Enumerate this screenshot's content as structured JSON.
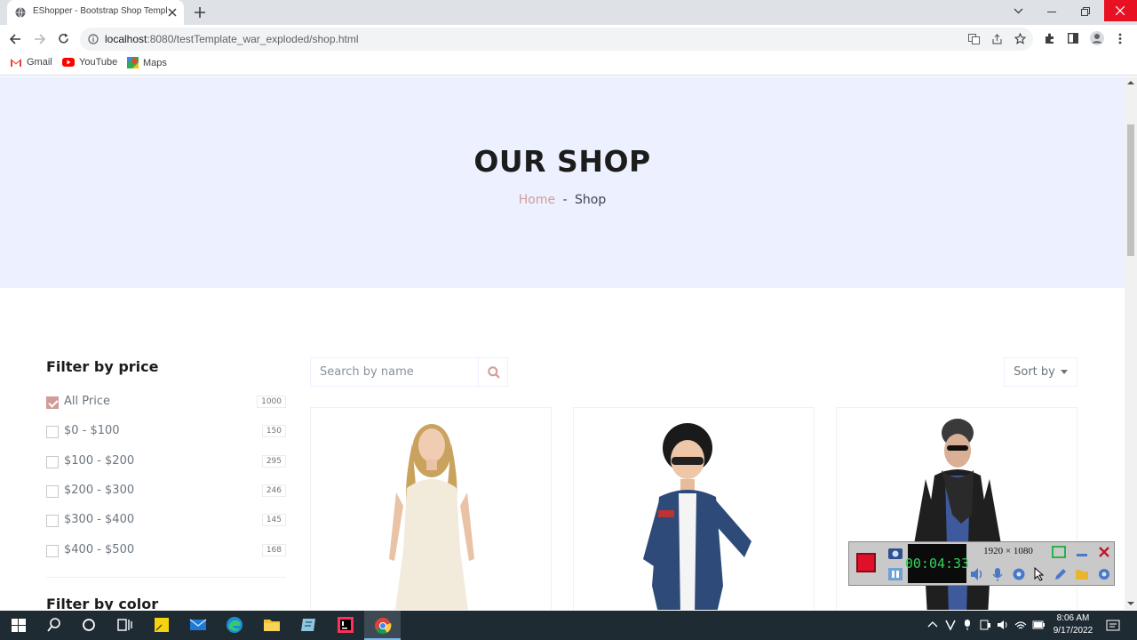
{
  "browser": {
    "tab_title": "EShopper - Bootstrap Shop Template",
    "url_host": "localhost",
    "url_rest": ":8080/testTemplate_war_exploded/shop.html",
    "bookmarks": [
      "Gmail",
      "YouTube",
      "Maps"
    ]
  },
  "hero": {
    "title": "OUR SHOP",
    "breadcrumb_home": "Home",
    "breadcrumb_sep": "-",
    "breadcrumb_current": "Shop"
  },
  "sidebar": {
    "price_heading": "Filter by price",
    "color_heading": "Filter by color",
    "price_filters": [
      {
        "label": "All Price",
        "count": "1000",
        "checked": true
      },
      {
        "label": "$0 - $100",
        "count": "150",
        "checked": false
      },
      {
        "label": "$100 - $200",
        "count": "295",
        "checked": false
      },
      {
        "label": "$200 - $300",
        "count": "246",
        "checked": false
      },
      {
        "label": "$300 - $400",
        "count": "145",
        "checked": false
      },
      {
        "label": "$400 - $500",
        "count": "168",
        "checked": false
      }
    ]
  },
  "toolbar": {
    "search_placeholder": "Search by name",
    "sort_label": "Sort by"
  },
  "recorder": {
    "time": "00:04:33",
    "resolution": "1920 × 1080"
  },
  "taskbar": {
    "time": "8:06 AM",
    "date": "9/17/2022"
  },
  "colors": {
    "accent": "#d19c97",
    "hero_bg": "#edf1ff",
    "taskbar_bg": "#1f2b33"
  }
}
